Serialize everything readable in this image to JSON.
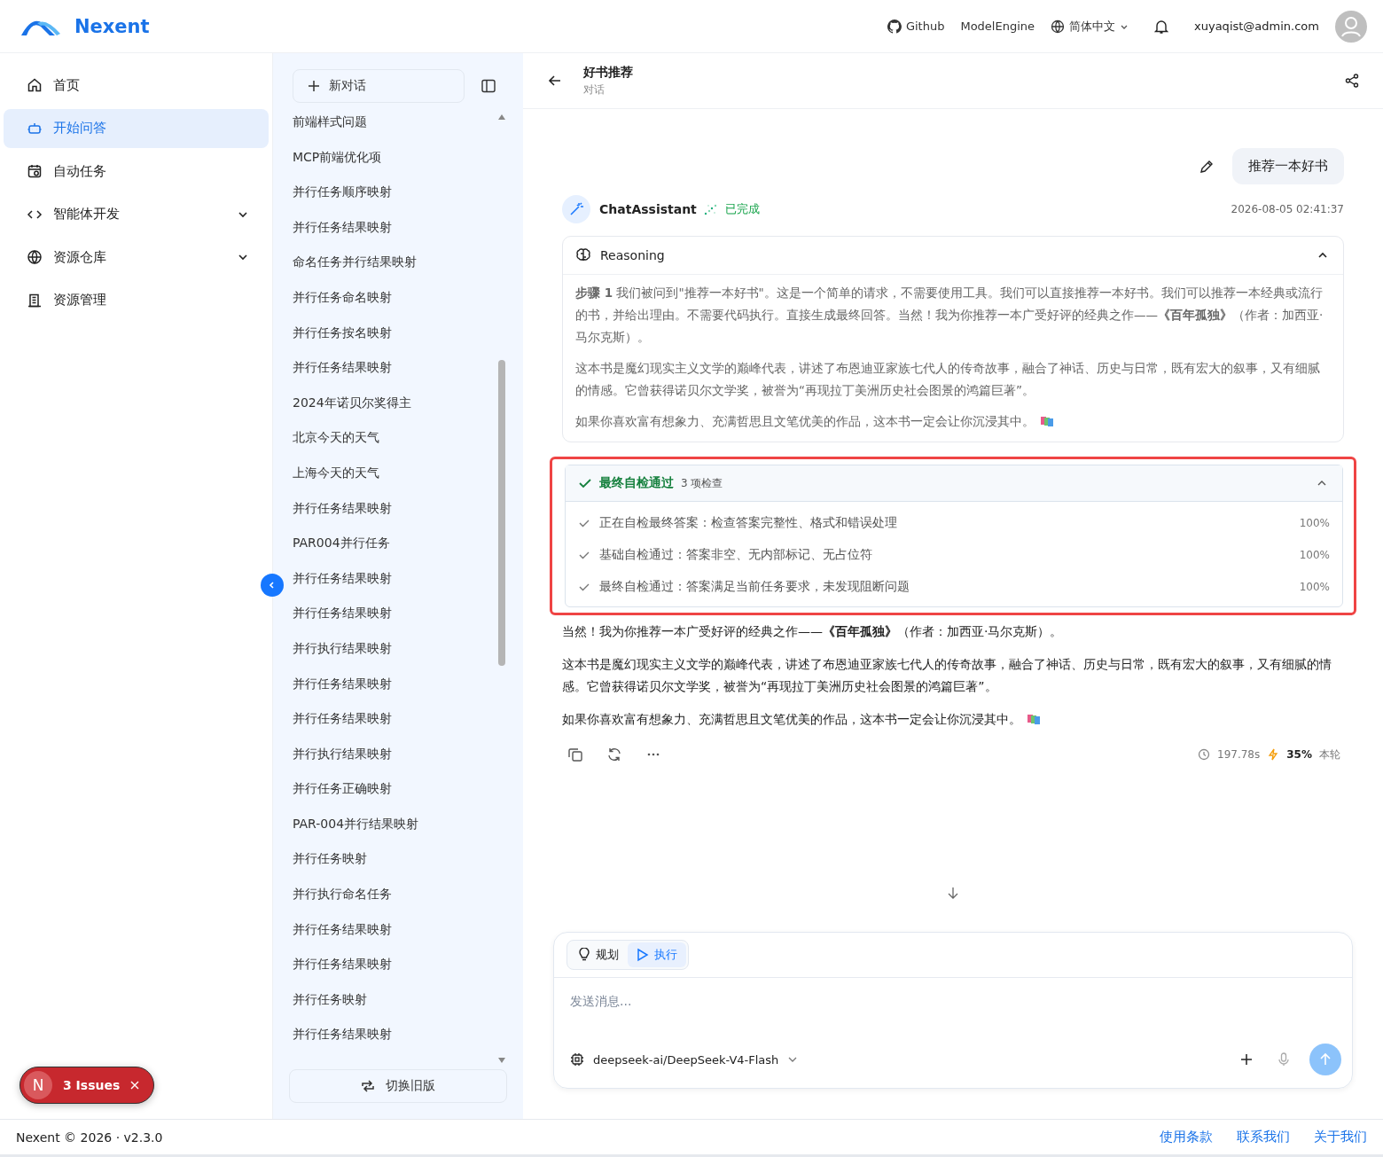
{
  "header": {
    "brand": "Nexent",
    "links": [
      "Github",
      "ModelEngine"
    ],
    "language": "简体中文",
    "user": "xuyaqist@admin.com"
  },
  "nav": [
    {
      "label": "首页",
      "selected": false,
      "has_submenu": false
    },
    {
      "label": "开始问答",
      "selected": true,
      "has_submenu": false
    },
    {
      "label": "自动任务",
      "selected": false,
      "has_submenu": false
    },
    {
      "label": "智能体开发",
      "selected": false,
      "has_submenu": true
    },
    {
      "label": "资源仓库",
      "selected": false,
      "has_submenu": true
    },
    {
      "label": "资源管理",
      "selected": false,
      "has_submenu": false
    }
  ],
  "conversations": {
    "new_chat": "新对话",
    "items": [
      "前端样式问题",
      "MCP前端优化项",
      "并行任务顺序映射",
      "并行任务结果映射",
      "命名任务并行结果映射",
      "并行任务命名映射",
      "并行任务按名映射",
      "并行任务结果映射",
      "2024年诺贝尔奖得主",
      "北京今天的天气",
      "上海今天的天气",
      "并行任务结果映射",
      "PAR004并行任务",
      "并行任务结果映射",
      "并行任务结果映射",
      "并行执行结果映射",
      "并行任务结果映射",
      "并行任务结果映射",
      "并行执行结果映射",
      "并行任务正确映射",
      "PAR-004并行结果映射",
      "并行任务映射",
      "并行执行命名任务",
      "并行任务结果映射",
      "并行任务结果映射",
      "并行任务映射",
      "并行任务结果映射"
    ],
    "switch_button": "切换旧版"
  },
  "chat": {
    "title": "好书推荐",
    "subtitle": "对话",
    "user_message": "推荐一本好书",
    "assistant": {
      "name": "ChatAssistant",
      "status": "已完成",
      "time": "2026-08-05 02:41:37"
    },
    "reasoning": {
      "title": "Reasoning",
      "expanded": true,
      "paragraphs": [
        "**步骤 1** 我们被问到\"推荐一本好书\"。这是一个简单的请求，不需要使用工具。我们可以直接推荐一本好书。我们可以推荐一本经典或流行的书，并给出理由。不需要代码执行。直接生成最终回答。当然！我为你推荐一本广受好评的经典之作——**《百年孤独》**（作者：加西亚·马尔克斯）。",
        "这本书是魔幻现实主义文学的巅峰代表，讲述了布恩迪亚家族七代人的传奇故事，融合了神话、历史与日常，既有宏大的叙事，又有细腻的情感。它曾获得诺贝尔文学奖，被誉为“再现拉丁美洲历史社会图景的鸿篇巨著”。",
        "如果你喜欢富有想象力、充满哲思且文笔优美的作品，这本书一定会让你沉浸其中。"
      ]
    },
    "self_check": {
      "title": "最终自检通过",
      "count": "3 项检查",
      "expanded": true,
      "highlighted": true,
      "items": [
        {
          "text": "正在自检最终答案：检查答案完整性、格式和错误处理",
          "percent": "100%"
        },
        {
          "text": "基础自检通过：答案非空、无内部标记、无占位符",
          "percent": "100%"
        },
        {
          "text": "最终自检通过：答案满足当前任务要求，未发现阻断问题",
          "percent": "100%"
        }
      ]
    },
    "answer": [
      "当然！我为你推荐一本广受好评的经典之作——**《百年孤独》**（作者：加西亚·马尔克斯）。",
      "这本书是魔幻现实主义文学的巅峰代表，讲述了布恩迪亚家族七代人的传奇故事，融合了神话、历史与日常，既有宏大的叙事，又有细腻的情感。它曾获得诺贝尔文学奖，被誉为“再现拉丁美洲历史社会图景的鸿篇巨著”。",
      "如果你喜欢富有想象力、充满哲思且文笔优美的作品，这本书一定会让你沉浸其中。"
    ],
    "stats": {
      "duration": "197.78s",
      "percent": "35%",
      "label": "本轮"
    }
  },
  "composer": {
    "modes": [
      {
        "label": "规划",
        "selected": false
      },
      {
        "label": "执行",
        "selected": true
      }
    ],
    "placeholder": "发送消息...",
    "model": "deepseek-ai/DeepSeek-V4-Flash"
  },
  "issues_badge": {
    "letter": "N",
    "label": "3 Issues"
  },
  "footer": {
    "copyright": "Nexent © 2026 · v2.3.0",
    "links": [
      "使用条款",
      "联系我们",
      "关于我们"
    ]
  }
}
